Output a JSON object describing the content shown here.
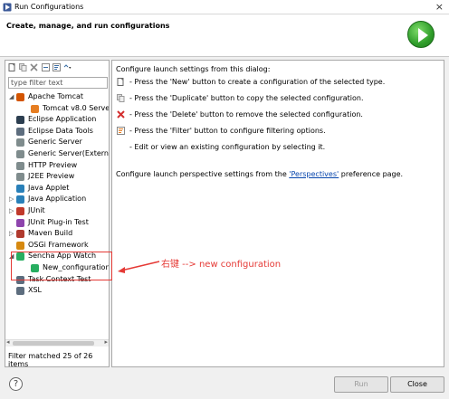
{
  "window": {
    "title": "Run Configurations",
    "close_glyph": "×"
  },
  "header": {
    "title": "Create, manage, and run configurations",
    "run_icon": "run-play-icon"
  },
  "left": {
    "filter_placeholder": "type filter text",
    "status": "Filter matched 25 of 26 items",
    "tree": [
      {
        "label": "Apache Tomcat",
        "depth": 1,
        "twisty": "◢",
        "color": "#d35400"
      },
      {
        "label": "Tomcat v8.0 Serve",
        "depth": 2,
        "twisty": "",
        "color": "#e67e22"
      },
      {
        "label": "Eclipse Application",
        "depth": 1,
        "twisty": "",
        "color": "#2c3e50"
      },
      {
        "label": "Eclipse Data Tools",
        "depth": 1,
        "twisty": "",
        "color": "#5d6d7e"
      },
      {
        "label": "Generic Server",
        "depth": 1,
        "twisty": "",
        "color": "#7f8c8d"
      },
      {
        "label": "Generic Server(Extern",
        "depth": 1,
        "twisty": "",
        "color": "#7f8c8d"
      },
      {
        "label": "HTTP Preview",
        "depth": 1,
        "twisty": "",
        "color": "#7f8c8d"
      },
      {
        "label": "J2EE Preview",
        "depth": 1,
        "twisty": "",
        "color": "#7f8c8d"
      },
      {
        "label": "Java Applet",
        "depth": 1,
        "twisty": "",
        "color": "#2980b9"
      },
      {
        "label": "Java Application",
        "depth": 1,
        "twisty": "▷",
        "color": "#2980b9"
      },
      {
        "label": "JUnit",
        "depth": 1,
        "twisty": "▷",
        "color": "#c0392b"
      },
      {
        "label": "JUnit Plug-in Test",
        "depth": 1,
        "twisty": "",
        "color": "#8e44ad"
      },
      {
        "label": "Maven Build",
        "depth": 1,
        "twisty": "▷",
        "color": "#b03a2e"
      },
      {
        "label": "OSGi Framework",
        "depth": 1,
        "twisty": "",
        "color": "#d68910"
      },
      {
        "label": "Sencha App Watch",
        "depth": 1,
        "twisty": "◢",
        "color": "#27ae60"
      },
      {
        "label": "New_configuration",
        "depth": 2,
        "twisty": "",
        "color": "#27ae60"
      },
      {
        "label": "Task Context Test",
        "depth": 1,
        "twisty": "",
        "color": "#5d6d7e"
      },
      {
        "label": "XSL",
        "depth": 1,
        "twisty": "",
        "color": "#5d6d7e"
      }
    ]
  },
  "right": {
    "intro": "Configure launch settings from this dialog:",
    "items": [
      {
        "text": "- Press the 'New' button to create a configuration of the selected type.",
        "icon": "new-config-icon"
      },
      {
        "text": "- Press the 'Duplicate' button to copy the selected configuration.",
        "icon": "duplicate-icon"
      },
      {
        "text": "- Press the 'Delete' button to remove the selected configuration.",
        "icon": "delete-icon"
      },
      {
        "text": "- Press the 'Filter' button to configure filtering options.",
        "icon": "filter-icon"
      },
      {
        "text": "- Edit or view an existing configuration by selecting it.",
        "icon": ""
      }
    ],
    "perspectives_pre": "Configure launch perspective settings from the ",
    "perspectives_link": "'Perspectives'",
    "perspectives_post": " preference page."
  },
  "annotation": {
    "text": "右键 --> new configuration",
    "color": "#e53935"
  },
  "buttons": {
    "run": "Run",
    "close": "Close",
    "help": "?"
  }
}
